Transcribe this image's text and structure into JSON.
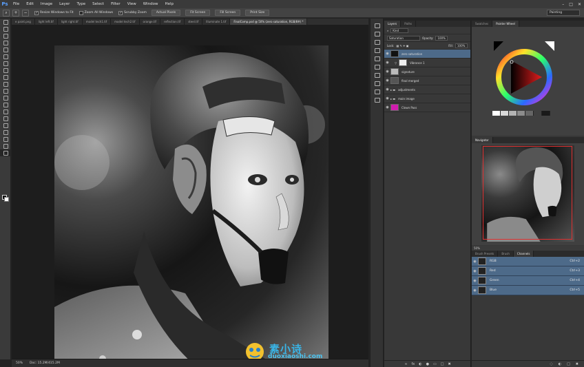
{
  "app": {
    "logo": "Ps"
  },
  "menu": [
    "File",
    "Edit",
    "Image",
    "Layer",
    "Type",
    "Select",
    "Filter",
    "View",
    "Window",
    "Help"
  ],
  "window_controls": {
    "minimize": "–",
    "restore": "□",
    "close": "✕"
  },
  "options": {
    "resize_label": "Resize Windows to Fit",
    "zoom_all_label": "Zoom All Windows",
    "scrubby_label": "Scrubby Zoom",
    "actual_pixels": "Actual Pixels",
    "fit_screen": "Fit Screen",
    "fill_screen": "Fill Screen",
    "print_size": "Print Size",
    "workspace": "Painting"
  },
  "doc_tabs": [
    {
      "label": "e paint.png",
      "active": false
    },
    {
      "label": "light left.tif",
      "active": false
    },
    {
      "label": "light right.tif",
      "active": false
    },
    {
      "label": "model tech1.tif",
      "active": false
    },
    {
      "label": "model tech2.tif",
      "active": false
    },
    {
      "label": "orange.tif",
      "active": false
    },
    {
      "label": "reflection.tif",
      "active": false
    },
    {
      "label": "steel.tif",
      "active": false
    },
    {
      "label": "Illuminate 1.tif",
      "active": false
    },
    {
      "label": "FinalComp.psd @ 50% (zero saturation, RGB/8#) *",
      "active": true
    }
  ],
  "watermark": {
    "brand": "素小诗",
    "url": "duoxiaoshi.com"
  },
  "status": {
    "zoom": "50%",
    "doc_info": "Doc: 15.2M/415.2M"
  },
  "layers": {
    "tabs": [
      "Layers",
      "Paths"
    ],
    "filter_kind": "Kind",
    "blend_mode": "Saturation",
    "opacity_label": "Opacity:",
    "opacity_value": "100%",
    "lock_label": "Lock:",
    "fill_label": "Fill:",
    "fill_value": "100%",
    "items": [
      {
        "name": "zero saturation",
        "selected": true,
        "thumb": "#111111"
      },
      {
        "name": "Vibrance 1",
        "selected": false,
        "thumb": "#eeeeee"
      },
      {
        "name": "signature",
        "selected": false,
        "thumb": "#bbbbbb"
      },
      {
        "name": "final merged",
        "selected": false,
        "thumb": "#555555"
      },
      {
        "name": "adjustments",
        "selected": false,
        "thumb": "#3a3a3a"
      },
      {
        "name": "main image",
        "selected": false,
        "thumb": "#3a3a3a"
      },
      {
        "name": "Clown Pass",
        "selected": false,
        "thumb": "#d01cae"
      }
    ]
  },
  "color_panel": {
    "tabs": [
      "Swatches",
      "Painter Wheel"
    ],
    "swatches": [
      "#ffffff",
      "#d9d9d9",
      "#b3b3b3",
      "#8c8c8c",
      "#666666",
      "#404040",
      "#1a1a1a"
    ]
  },
  "navigator": {
    "title": "Navigator",
    "zoom": "50%"
  },
  "channels": {
    "tabs": [
      "Brush Presets",
      "Brush",
      "Channels"
    ],
    "items": [
      {
        "name": "RGB",
        "key": "Ctrl+2"
      },
      {
        "name": "Red",
        "key": "Ctrl+3"
      },
      {
        "name": "Green",
        "key": "Ctrl+4"
      },
      {
        "name": "Blue",
        "key": "Ctrl+5"
      }
    ]
  }
}
